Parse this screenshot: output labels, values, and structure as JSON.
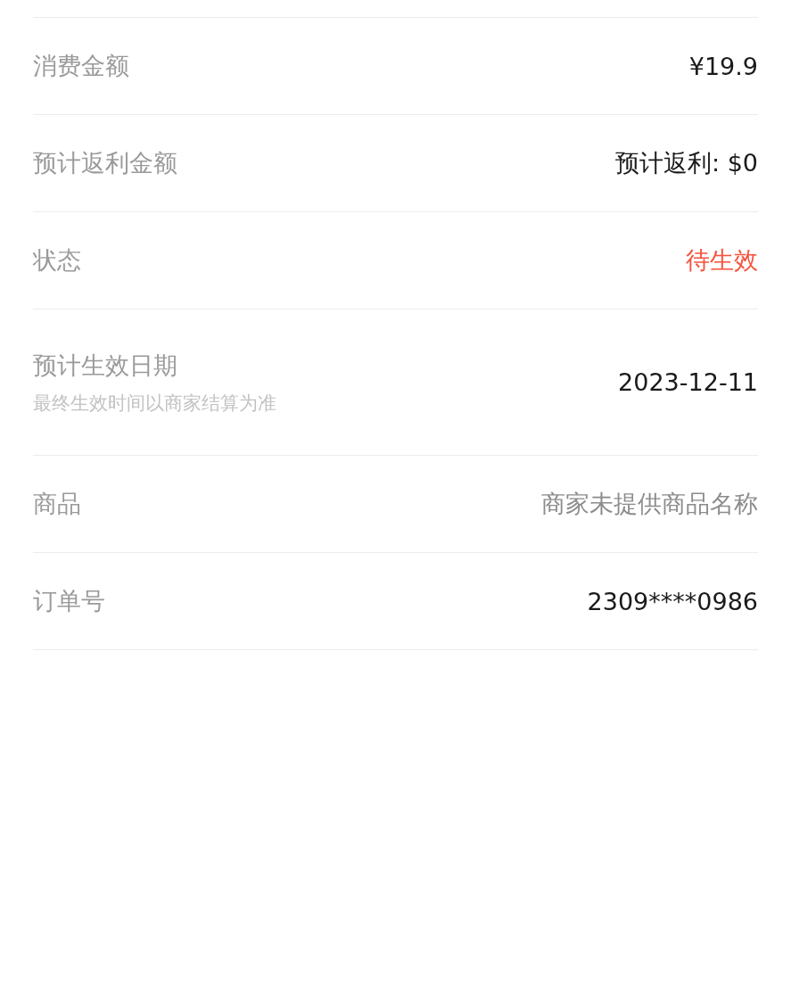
{
  "rows": [
    {
      "label": "消费金额",
      "value": "¥19.9",
      "color": "#1a1a1a"
    },
    {
      "label": "预计返利金额",
      "value": "预计返利: $0",
      "color": "#1a1a1a"
    },
    {
      "label": "状态",
      "value": "待生效",
      "color": "#f5533d"
    },
    {
      "label": "预计生效日期",
      "note": "最终生效时间以商家结算为准",
      "value": "2023-12-11",
      "color": "#1a1a1a"
    },
    {
      "label": "商品",
      "value": "商家未提供商品名称",
      "color": "#8c8c8c"
    },
    {
      "label": "订单号",
      "value": "2309****0986",
      "color": "#1a1a1a"
    }
  ]
}
